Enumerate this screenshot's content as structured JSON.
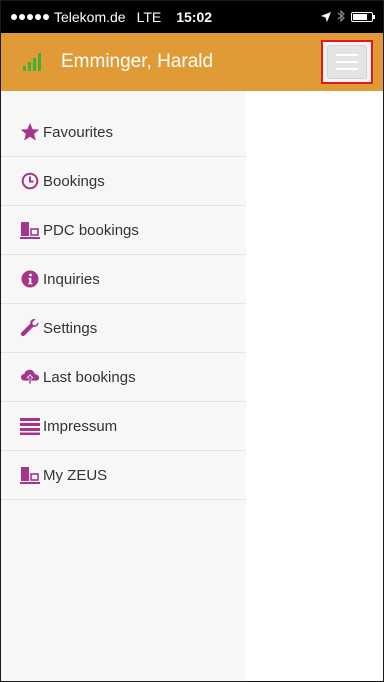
{
  "status_bar": {
    "carrier": "Telekom.de",
    "network": "LTE",
    "time": "15:02"
  },
  "header": {
    "title": "Emminger, Harald"
  },
  "colors": {
    "header_bg": "#e09a36",
    "icon_purple": "#a5348b",
    "signal_green": "#3fb137",
    "highlight_red": "#e0171f"
  },
  "menu": {
    "items": [
      {
        "label": "Favourites",
        "icon": "star-icon"
      },
      {
        "label": "Bookings",
        "icon": "clock-icon"
      },
      {
        "label": "PDC bookings",
        "icon": "pdc-icon"
      },
      {
        "label": "Inquiries",
        "icon": "info-icon"
      },
      {
        "label": "Settings",
        "icon": "wrench-icon"
      },
      {
        "label": "Last bookings",
        "icon": "cloud-upload-icon"
      },
      {
        "label": "Impressum",
        "icon": "list-icon"
      },
      {
        "label": "My ZEUS",
        "icon": "zeus-icon"
      }
    ]
  }
}
